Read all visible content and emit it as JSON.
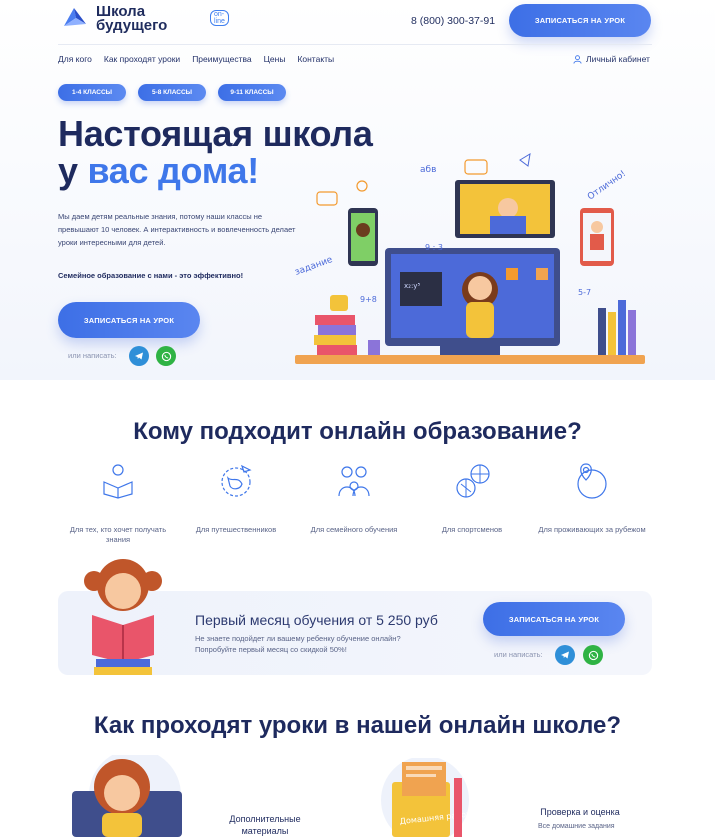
{
  "header": {
    "logo_line1": "Школа",
    "logo_line2": "будущего",
    "logo_badge": "on-line",
    "phone": "8 (800) 300-37-91",
    "cta": "ЗАПИСАТЬСЯ НА УРОК"
  },
  "nav": {
    "items": [
      "Для кого",
      "Как проходят уроки",
      "Преимущества",
      "Цены",
      "Контакты"
    ],
    "account": "Личный кабинет"
  },
  "hero": {
    "pills": [
      "1-4 КЛАССЫ",
      "5-8 КЛАССЫ",
      "9-11 КЛАССЫ"
    ],
    "title_line1": "Настоящая школа",
    "title_line2_a": "у ",
    "title_line2_b": "вас дома!",
    "lead": "Мы даем детям реальные знания, потому наши классы не превышают 10 человек. А интерактивность и вовлеченность делает уроки интересными для детей.",
    "strong": "Семейное образование с нами - это эффективно!",
    "cta": "ЗАПИСАТЬСЯ НА УРОК",
    "write_label": "или написать:",
    "illustration_text": [
      "абв",
      "Отлично!",
      "задание",
      "9 : 3",
      "9+8",
      "5-7"
    ]
  },
  "audience": {
    "title": "Кому подходит онлайн образование?",
    "items": [
      {
        "label": "Для тех, кто хочет получать знания",
        "icon": "book-reader-icon"
      },
      {
        "label": "Для путешественников",
        "icon": "globe-plane-icon"
      },
      {
        "label": "Для семейного обучения",
        "icon": "family-icon"
      },
      {
        "label": "Для спортсменов",
        "icon": "balls-icon"
      },
      {
        "label": "Для проживающих за рубежом",
        "icon": "map-pin-icon"
      }
    ]
  },
  "promo": {
    "title": "Первый месяц обучения от 5 250 руб",
    "sub_line1": "Не знаете подойдет ли вашему ребенку обучение онлайн?",
    "sub_line2": "Попробуйте первый месяц со скидкой 50%!",
    "cta": "ЗАПИСАТЬСЯ НА УРОК",
    "write_label": "или написать:"
  },
  "lessons": {
    "title": "Как проходят уроки в нашей онлайн школе?",
    "step2_line1": "Дополнительные",
    "step2_line2": "материалы",
    "step4_title": "Проверка и оценка",
    "step4_sub": "Все домашние задания",
    "homework_note": "Домашняя работа"
  },
  "colors": {
    "brand": "#3f77ea",
    "dark": "#1e2a5e",
    "telegram": "#2f8fd8",
    "whatsapp": "#2fb344"
  }
}
